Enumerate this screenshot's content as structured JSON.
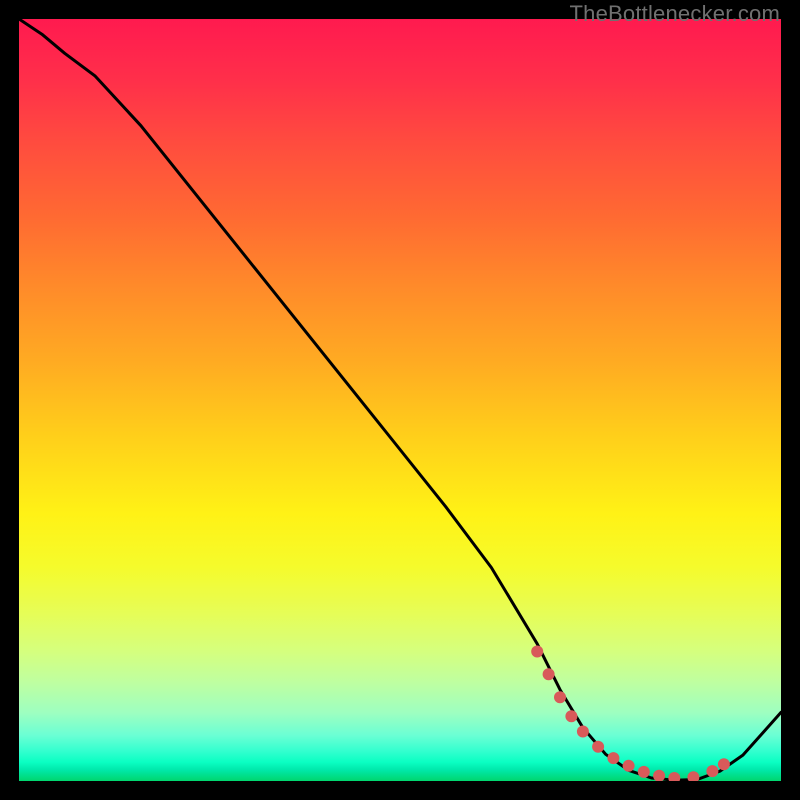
{
  "watermark": "TheBottlenecker.com",
  "colors": {
    "background": "#000000",
    "gradient_top": "#ff1a4f",
    "gradient_mid": "#ffd01a",
    "gradient_bottom": "#00d66e",
    "curve": "#000000",
    "markers": "#d85a5a"
  },
  "chart_data": {
    "type": "line",
    "title": "",
    "xlabel": "",
    "ylabel": "",
    "xlim": [
      0,
      100
    ],
    "ylim": [
      0,
      100
    ],
    "series": [
      {
        "name": "bottleneck-curve",
        "x": [
          0,
          3,
          6,
          10,
          16,
          24,
          32,
          40,
          48,
          56,
          62,
          68,
          71,
          74,
          77,
          80,
          83,
          86,
          89,
          92,
          95,
          100
        ],
        "y": [
          100,
          98,
          95.5,
          92.5,
          86,
          76,
          66,
          56,
          46,
          36,
          28,
          18,
          12,
          7,
          3.5,
          1.4,
          0.4,
          0.1,
          0.2,
          1.3,
          3.4,
          9
        ]
      }
    ],
    "markers": {
      "name": "highlight-dots",
      "x": [
        68,
        69.5,
        71,
        72.5,
        74,
        76,
        78,
        80,
        82,
        84,
        86,
        88.5,
        91,
        92.5
      ],
      "y": [
        17,
        14,
        11,
        8.5,
        6.5,
        4.5,
        3,
        2,
        1.2,
        0.7,
        0.4,
        0.5,
        1.3,
        2.2
      ]
    }
  }
}
